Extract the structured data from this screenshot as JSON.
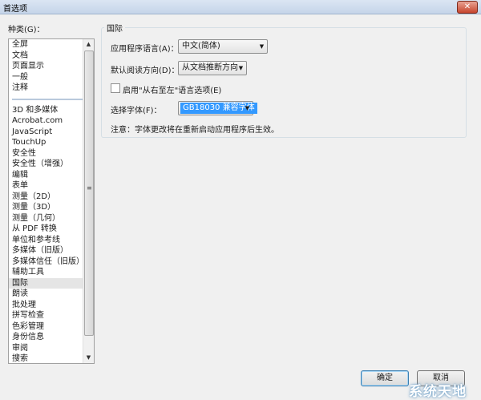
{
  "window": {
    "title": "首选项",
    "close_symbol": "✕"
  },
  "categories": {
    "label": "种类(G)：",
    "group1": [
      "全屏",
      "文档",
      "页面显示",
      "一般",
      "注释"
    ],
    "group2": [
      "3D 和多媒体",
      "Acrobat.com",
      "JavaScript",
      "TouchUp",
      "安全性",
      "安全性（增强）",
      "编辑",
      "表单",
      "测量（2D）",
      "测量（3D）",
      "测量（几何）",
      "从 PDF 转换",
      "单位和参考线",
      "多媒体（旧版）",
      "多媒体信任（旧版）",
      "辅助工具",
      "国际",
      "朗读",
      "批处理",
      "拼写检查",
      "色彩管理",
      "身份信息",
      "审阅",
      "搜索"
    ],
    "selected": "国际"
  },
  "panel": {
    "group_title": "国际",
    "app_language": {
      "label": "应用程序语言(A)：",
      "value": "中文(简体)"
    },
    "reading_direction": {
      "label": "默认阅读方向(D)：",
      "value": "从文档推断方向"
    },
    "rtl_option": {
      "label": "启用\"从右至左\"语言选项(E)",
      "checked": false
    },
    "font": {
      "label": "选择字体(F)：",
      "value": "GB18030 兼容字体"
    },
    "note": "注意：字体更改将在重新启动应用程序后生效。"
  },
  "buttons": {
    "ok": "确定",
    "cancel": "取消"
  },
  "watermark": "系统天地"
}
